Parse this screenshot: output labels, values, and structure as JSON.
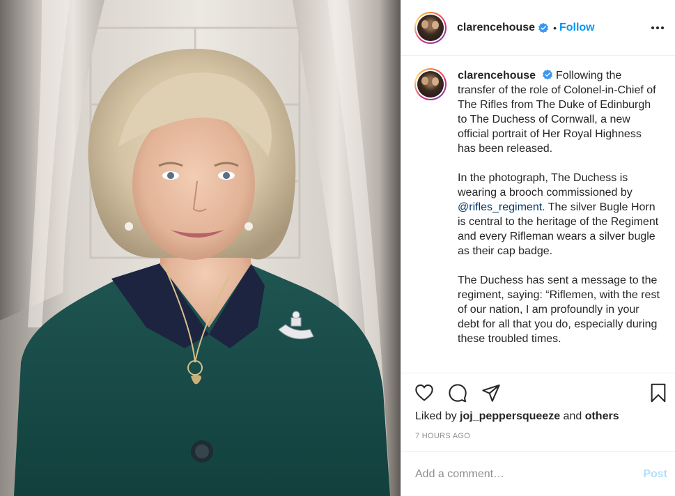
{
  "post": {
    "username": "clarencehouse",
    "follow_label": "Follow",
    "dot_separator": "•",
    "caption_paragraphs": [
      "Following the transfer of the role of Colonel-in-Chief of The Rifles from The Duke of Edinburgh to The Duchess of Cornwall, a new official portrait of Her Royal Highness has been released.",
      "In the photograph, The Duchess is wearing a brooch commissioned by",
      "The Duchess has sent a message to the regiment, saying: “Riflemen, with the rest of our nation, I am profoundly in your debt for all that you do, especially during these troubled times."
    ],
    "mention": "@rifles_regiment",
    "caption_p2_rest": ". The silver Bugle Horn is central to the heritage of the Regiment and every Rifleman wears a silver bugle as their cap badge.",
    "likes_prefix": "Liked by",
    "liked_by_user": "joj_peppersqueeze",
    "likes_and": "and",
    "likes_others": "others",
    "timestamp": "7 HOURS AGO",
    "comment_placeholder": "Add a comment…",
    "post_label": "Post"
  },
  "icons": {
    "verified": "verified-badge-icon",
    "more": "more-options-icon",
    "like": "heart-icon",
    "comment": "comment-icon",
    "share": "share-icon",
    "save": "bookmark-icon"
  },
  "colors": {
    "accent": "#0095f6",
    "mention": "#00376b",
    "muted": "#8e8e8e",
    "post_disabled": "#b2dffc"
  }
}
